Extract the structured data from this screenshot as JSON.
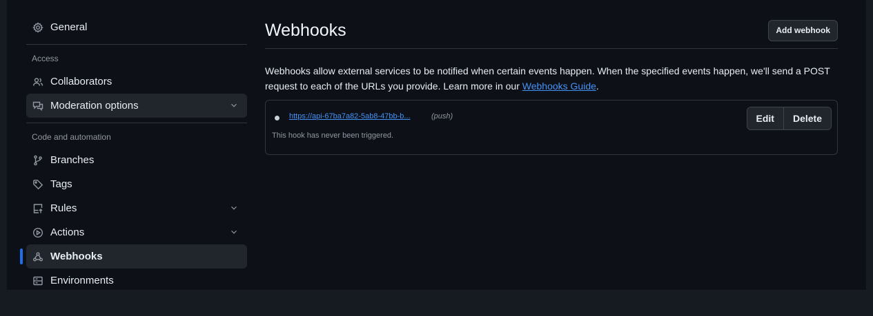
{
  "sidebar": {
    "top_items": [
      {
        "label": "General",
        "icon": "gear-icon"
      },
      {
        "label": "Access",
        "heading": true
      },
      {
        "label": "Collaborators",
        "icon": "people-icon"
      },
      {
        "label": "Moderation options",
        "icon": "comment-discussion-icon"
      }
    ],
    "section1_heading": "Access",
    "general": "General",
    "collaborators": "Collaborators",
    "moderation": "Moderation options",
    "section2_heading": "Code and automation",
    "branches": "Branches",
    "tags": "Tags",
    "rules": "Rules",
    "actions": "Actions",
    "webhooks": "Webhooks",
    "environments": "Environments"
  },
  "main": {
    "title": "Webhooks",
    "add_button": "Add webhook",
    "description": "Webhooks allow external services to be notified when certain events happen. When the specified events happen, we'll send a POST request to each of the URLs you provide. Learn more in our ",
    "guide_link": "Webhooks Guide",
    "description_end": "."
  },
  "hook": {
    "url": "https://api-67ba7a82-5ab8-47bb-b...",
    "event": "(push)",
    "status": "This hook has never been triggered.",
    "edit_label": "Edit",
    "delete_label": "Delete"
  },
  "colors": {
    "background": "#0d1117",
    "accent": "#1f6feb",
    "link": "#4493f8"
  }
}
